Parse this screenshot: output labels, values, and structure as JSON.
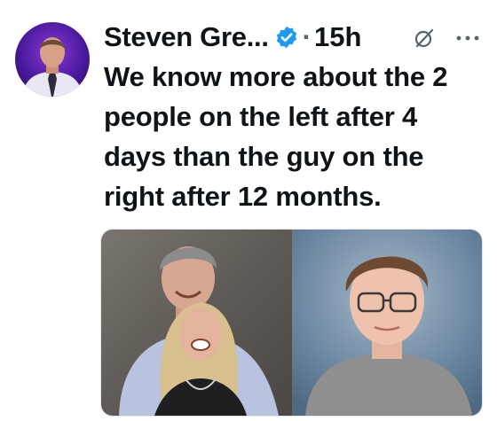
{
  "tweet": {
    "author_name": "Steven Gre...",
    "separator": "·",
    "timestamp": "15h",
    "text": "We know more about the 2 people on the left after 4 days than the guy on the right after 12 months.",
    "media": {
      "left_photo": "couple-photo",
      "right_photo": "portrait-photo"
    }
  },
  "icons": {
    "verified": "verified-badge-icon",
    "grok": "grok-icon",
    "more": "more-options-icon"
  },
  "colors": {
    "verified_blue": "#1d9bf0",
    "text_primary": "#0f1419",
    "text_secondary": "#536471",
    "background": "#ffffff"
  }
}
